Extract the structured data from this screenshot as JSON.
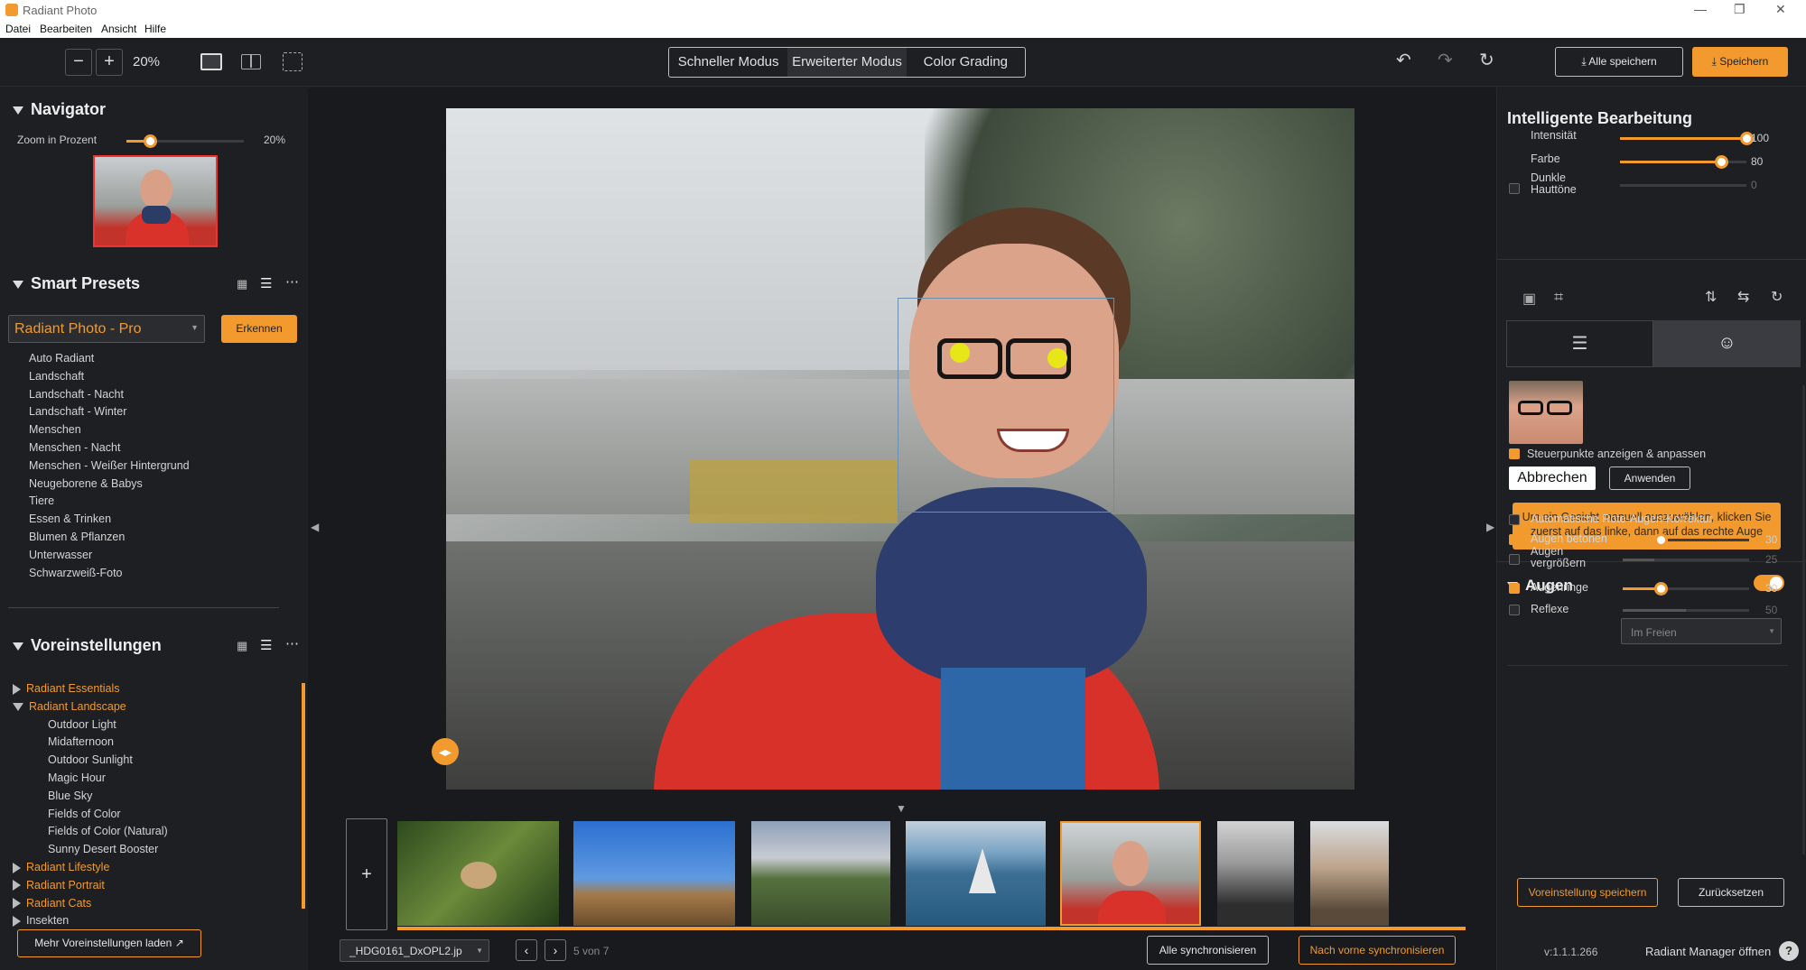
{
  "window": {
    "title": "Radiant Photo",
    "controls": [
      "—",
      "❐",
      "✕"
    ]
  },
  "menu": [
    "Datei",
    "Bearbeiten",
    "Ansicht",
    "Hilfe"
  ],
  "toolbar": {
    "zoom_minus": "−",
    "zoom_plus": "+",
    "zoom_level": "20%",
    "modes": [
      "Schneller Modus",
      "Erweiterter Modus",
      "Color Grading"
    ],
    "save_all": "⤓ Alle speichern",
    "save": "⤓ Speichern"
  },
  "navigator": {
    "title": "Navigator",
    "zoom_label": "Zoom in Prozent",
    "zoom_value": "20%",
    "zoom_fraction": 0.2
  },
  "smart_presets": {
    "title": "Smart Presets",
    "dropdown": "Radiant Photo - Pro",
    "detect_btn": "Erkennen",
    "items": [
      "Auto Radiant",
      "Landschaft",
      "Landschaft - Nacht",
      "Landschaft - Winter",
      "Menschen",
      "Menschen - Nacht",
      "Menschen - Weißer Hintergrund",
      "Neugeborene & Babys",
      "Tiere",
      "Essen & Trinken",
      "Blumen & Pflanzen",
      "Unterwasser",
      "Schwarzweiß-Foto"
    ]
  },
  "presets": {
    "title": "Voreinstellungen",
    "tree": [
      {
        "label": "Radiant Essentials",
        "type": "cat",
        "open": false
      },
      {
        "label": "Radiant Landscape",
        "type": "cat",
        "open": true
      },
      {
        "label": "Outdoor Light",
        "type": "child"
      },
      {
        "label": "Midafternoon",
        "type": "child"
      },
      {
        "label": "Outdoor Sunlight",
        "type": "child"
      },
      {
        "label": "Magic Hour",
        "type": "child"
      },
      {
        "label": "Blue Sky",
        "type": "child"
      },
      {
        "label": "Fields of Color",
        "type": "child"
      },
      {
        "label": "Fields of Color (Natural)",
        "type": "child"
      },
      {
        "label": "Sunny Desert Booster",
        "type": "child"
      },
      {
        "label": "Radiant Lifestyle",
        "type": "cat",
        "open": false
      },
      {
        "label": "Radiant Portrait",
        "type": "cat",
        "open": false
      },
      {
        "label": "Radiant Cats",
        "type": "cat",
        "open": false
      },
      {
        "label": "Insekten",
        "type": "plain",
        "open": false
      }
    ],
    "more_btn": "Mehr Voreinstellungen laden"
  },
  "filmstrip": {
    "filename": "_HDG0161_DxOPL2.jp",
    "counter": "5 von 7",
    "sync_all": "Alle synchronisieren",
    "sync_forward": "Nach vorne synchronisieren",
    "add": "+"
  },
  "smart_edit": {
    "title": "Intelligente Bearbeitung",
    "sliders": [
      {
        "label": "Intensität",
        "value": "100",
        "fraction": 1.0
      },
      {
        "label": "Farbe",
        "value": "80",
        "fraction": 0.8
      },
      {
        "label": "Dunkle Hauttöne",
        "value": "0",
        "fraction": 0.0
      }
    ]
  },
  "face": {
    "show_points": "Steuerpunkte anzeigen & anpassen",
    "cancel": "Abbrechen",
    "apply": "Anwenden",
    "hint": "Um ein Gesicht manuell auszuwählen, klicken Sie zuerst auf das linke, dann auf das rechte Auge"
  },
  "eyes": {
    "title": "Augen",
    "rows": [
      {
        "label": "Automatische Rote-Augen-Korrektur",
        "checked": false,
        "slider": false
      },
      {
        "label": "Augen betonen",
        "checked": true,
        "value": "30",
        "fraction": 0.3,
        "slider": true
      },
      {
        "label": "Augen vergrößern",
        "checked": false,
        "value": "25",
        "fraction": 0.25,
        "slider": true
      },
      {
        "label": "Augenringe",
        "checked": true,
        "value": "30",
        "fraction": 0.3,
        "slider": true
      },
      {
        "label": "Reflexe",
        "checked": false,
        "value": "50",
        "fraction": 0.5,
        "slider": true
      }
    ],
    "reflex_mode": "Im Freien"
  },
  "footer": {
    "save_preset": "Voreinstellung speichern",
    "reset": "Zurücksetzen",
    "version": "v:1.1.1.266",
    "manager": "Radiant Manager öffnen",
    "help": "?"
  },
  "colors": {
    "accent": "#f29a2e",
    "panel": "#1e1f23",
    "canvas": "#191a1d"
  }
}
